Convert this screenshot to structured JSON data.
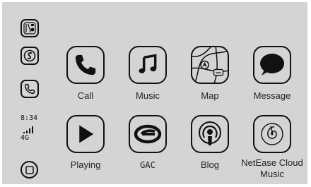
{
  "sidebar": {
    "icons": [
      "app-grid-icon",
      "circle-s-icon",
      "phone-icon"
    ],
    "status": {
      "time": "8:34",
      "network": "4G",
      "signal_icon": "signal-bars-icon"
    },
    "home_icon": "square-home-icon"
  },
  "apps": [
    {
      "label": "Call",
      "icon": "phone-icon"
    },
    {
      "label": "Music",
      "icon": "music-note-icon"
    },
    {
      "label": "Map",
      "icon": "map-icon"
    },
    {
      "label": "Message",
      "icon": "speech-bubble-icon"
    },
    {
      "label": "Playing",
      "icon": "play-icon"
    },
    {
      "label": "GAC",
      "icon": "gac-logo-icon"
    },
    {
      "label": "Blog",
      "icon": "podcast-icon"
    },
    {
      "label": "NetEase Cloud Music",
      "icon": "netease-cloud-music-icon"
    }
  ],
  "colors": {
    "background": "#d4d4d4",
    "icon_stroke": "#111111"
  }
}
